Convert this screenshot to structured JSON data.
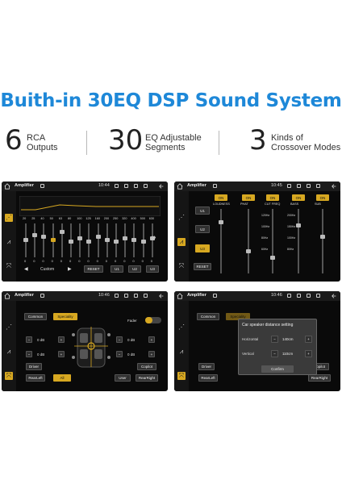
{
  "headline": "Buith-in 30EQ DSP Sound System",
  "features": [
    {
      "number": "6",
      "line1": "RCA",
      "line2": "Outputs"
    },
    {
      "number": "30",
      "line1": "EQ Adjustable",
      "line2": "Segments"
    },
    {
      "number": "3",
      "line1": "Kinds of",
      "line2": "Crossover Modes"
    }
  ],
  "colors": {
    "brand_blue": "#1e88d8",
    "accent_gold": "#d7a821",
    "screen_bg": "#0a0a0a"
  },
  "screen1": {
    "title": "Amplifier",
    "time": "10:44",
    "freqs": [
      "20",
      "25",
      "40",
      "50",
      "63",
      "80",
      "100",
      "125",
      "160",
      "200",
      "250",
      "320",
      "400",
      "500",
      "630"
    ],
    "values": [
      "0",
      "0",
      "0",
      "0",
      "0",
      "0",
      "0",
      "0",
      "0",
      "0",
      "0",
      "0",
      "0",
      "0",
      "0"
    ],
    "preset": "Custom",
    "reset_label": "RESET",
    "user_buttons": [
      "U1",
      "U2",
      "U3"
    ]
  },
  "screen2": {
    "title": "Amplifier",
    "time": "10:45",
    "user_buttons": [
      "U1",
      "U2",
      "U3"
    ],
    "reset_label": "RESET",
    "on_label": "ON",
    "columns": [
      "LOUDNESS",
      "PHAT",
      "CUT FREQ",
      "BASS",
      "SUB"
    ],
    "cut_freq": [
      "120Hz",
      "100Hz",
      "80Hz",
      "60Hz"
    ],
    "bass_freq": [
      "200Hz",
      "150Hz",
      "100Hz",
      "80Hz"
    ]
  },
  "screen3": {
    "title": "Amplifier",
    "time": "10:46",
    "tabs": [
      "Common",
      "Speciality"
    ],
    "fader_label": "Fader",
    "db_value": "0 dB",
    "buttons": [
      "Driver",
      "Copilot",
      "RearLeft",
      "All",
      "User",
      "RearRight"
    ]
  },
  "screen4": {
    "title": "Amplifier",
    "time": "10:46",
    "tabs": [
      "Common",
      "Speciality"
    ],
    "dialog_title": "Car speaker distance setting",
    "horizontal_label": "Horizontal",
    "horizontal_value": "140cm",
    "vertical_label": "Vertical",
    "vertical_value": "110cm",
    "confirm_label": "Confirm",
    "buttons": [
      "Driver",
      "Copilot",
      "RearLeft",
      "RearRight"
    ]
  }
}
